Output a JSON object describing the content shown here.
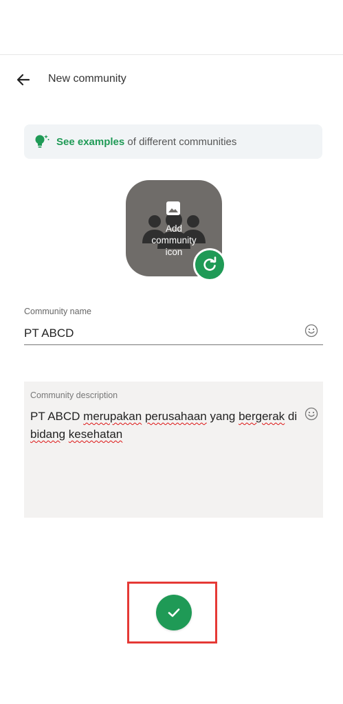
{
  "header": {
    "title": "New community"
  },
  "tip": {
    "link": "See examples",
    "rest": " of different communities"
  },
  "icon": {
    "label": "Add\ncommunity\nicon"
  },
  "name": {
    "label": "Community name",
    "value": "PT ABCD"
  },
  "description": {
    "label": "Community description",
    "value": "PT ABCD merupakan perusahaan yang bergerak di bidang kesehatan",
    "parts": [
      {
        "t": "PT ABCD ",
        "s": false
      },
      {
        "t": "merupakan",
        "s": true
      },
      {
        "t": " ",
        "s": false
      },
      {
        "t": "perusahaan",
        "s": true
      },
      {
        "t": " yang ",
        "s": false
      },
      {
        "t": "bergerak",
        "s": true
      },
      {
        "t": " di ",
        "s": false
      },
      {
        "t": "bidang",
        "s": true
      },
      {
        "t": " ",
        "s": false
      },
      {
        "t": "kesehatan",
        "s": true
      }
    ]
  },
  "colors": {
    "accent": "#1f9a56",
    "highlight": "#e53935",
    "icon_bg": "#6f6c69"
  }
}
